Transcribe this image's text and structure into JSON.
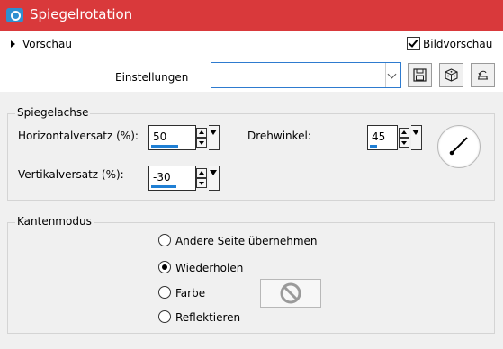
{
  "window": {
    "title": "Spiegelrotation"
  },
  "header": {
    "preview_toggle_label": "Vorschau",
    "image_preview_label": "Bildvorschau",
    "image_preview_checked": true
  },
  "settings": {
    "label": "Einstellungen",
    "value": "",
    "buttons": [
      "save-icon",
      "randomize-dice-icon",
      "reset-icon"
    ]
  },
  "mirror_axis": {
    "title": "Spiegelachse",
    "horizontal_offset": {
      "label": "Horizontalversatz (%):",
      "value": "50"
    },
    "vertical_offset": {
      "label": "Vertikalversatz (%):",
      "value": "-30"
    },
    "rotation": {
      "label": "Drehwinkel:",
      "value": "45"
    }
  },
  "edge_mode": {
    "title": "Kantenmodus",
    "options": [
      {
        "label": "Andere Seite übernehmen",
        "selected": false
      },
      {
        "label": "Wiederholen",
        "selected": true
      },
      {
        "label": "Farbe",
        "selected": false
      },
      {
        "label": "Reflektieren",
        "selected": false
      }
    ]
  },
  "colors": {
    "titlebar": "#d9393b",
    "accent": "#1f7fd4"
  }
}
